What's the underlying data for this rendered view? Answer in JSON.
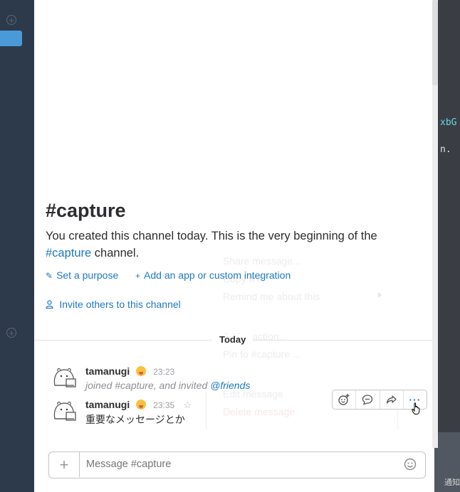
{
  "channel": {
    "title": "#capture",
    "desc_prefix": "You created this channel today. This is the very beginning of the",
    "desc_link": "#capture",
    "desc_suffix": " channel."
  },
  "actions": {
    "purpose": "Set a purpose",
    "add_app": "Add an app or custom integration",
    "invite": "Invite others to this channel"
  },
  "ghost_menu": {
    "share": "Share message...",
    "copy": "Copy link",
    "remind": "Remind me about this",
    "reaction": "Add reaction...",
    "pin": "Pin to #capture ...",
    "edit": "Edit message",
    "delete": "Delete message"
  },
  "divider": {
    "label": "Today"
  },
  "messages": [
    {
      "author": "tamanugi",
      "time": "23:23",
      "joined_text": "joined #capture, and invited ",
      "mention": "@friends"
    },
    {
      "author": "tamanugi",
      "time": "23:35",
      "text": "重要なメッセージとか"
    }
  ],
  "toolbar": {
    "reaction_icon": "add-reaction-icon",
    "thread_icon": "thread-icon",
    "share_icon": "share-icon",
    "more_label": "···"
  },
  "composer": {
    "placeholder": "Message #capture",
    "plus": "+"
  },
  "terminal": {
    "line1": "xbG",
    "line2": "n.",
    "line3": "通知"
  },
  "colors": {
    "link": "#1d79c0",
    "sidebar": "#2d3a4b",
    "accent": "#4b9ad8"
  }
}
